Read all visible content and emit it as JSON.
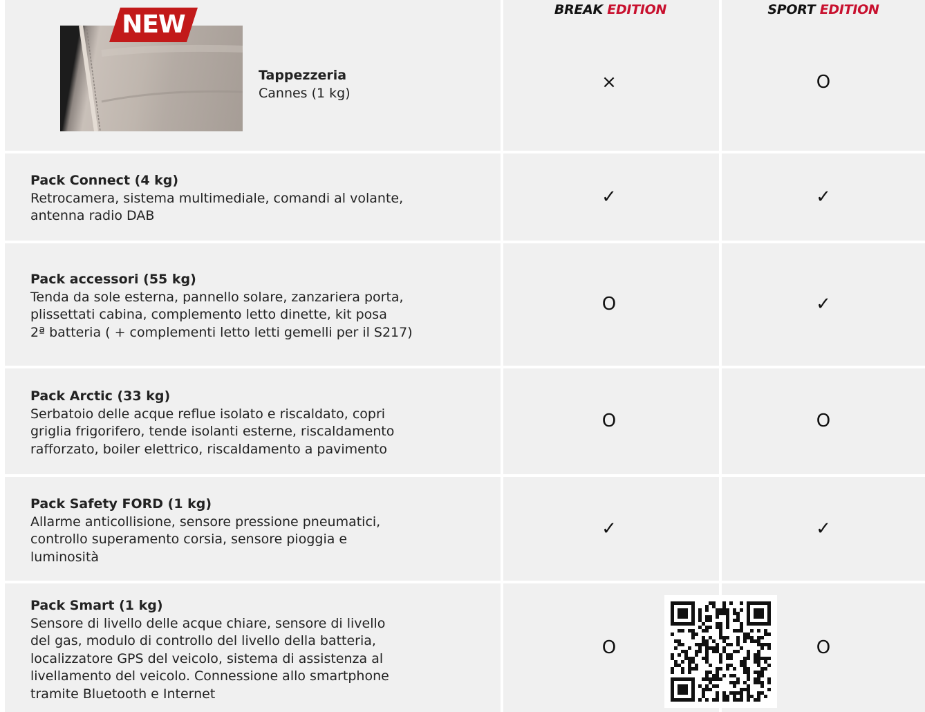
{
  "header": {
    "col1_word": "BREAK",
    "col1_edition": "EDITION",
    "col2_word": "SPORT",
    "col2_edition": "EDITION",
    "accent_color": "#c8102e"
  },
  "badge": {
    "label": "NEW"
  },
  "rows": [
    {
      "title": "Tappezzeria",
      "lines": [
        "Cannes (1 kg)"
      ],
      "break": "×",
      "sport": "O"
    },
    {
      "title": "Pack Connect (4 kg)",
      "lines": [
        "Retrocamera, sistema multimediale, comandi al volante,",
        "antenna radio DAB"
      ],
      "break": "✓",
      "sport": "✓"
    },
    {
      "title": "Pack accessori (55 kg)",
      "lines": [
        "Tenda da sole esterna, pannello solare, zanzariera porta,",
        "plissettati cabina, complemento letto dinette, kit posa",
        "2ª batteria ( + complementi letto letti gemelli per il S217)"
      ],
      "break": "O",
      "sport": "✓"
    },
    {
      "title": "Pack Arctic (33 kg)",
      "lines": [
        "Serbatoio delle acque reflue isolato e riscaldato, copri",
        "griglia frigorifero, tende isolanti esterne, riscaldamento",
        "rafforzato, boiler elettrico, riscaldamento a pavimento"
      ],
      "break": "O",
      "sport": "O"
    },
    {
      "title": "Pack Safety FORD (1 kg)",
      "lines": [
        "Allarme anticollisione, sensore pressione pneumatici,",
        "controllo superamento corsia, sensore pioggia e",
        "luminosità"
      ],
      "break": "✓",
      "sport": "✓"
    },
    {
      "title": "Pack Smart (1 kg)",
      "lines": [
        "Sensore di livello delle acque chiare, sensore di livello",
        "del gas, modulo di controllo del livello della batteria,",
        "localizzatore GPS del veicolo, sistema di assistenza al",
        "livellamento del veicolo. Connessione allo smartphone",
        "tramite Bluetooth e Internet"
      ],
      "break": "O",
      "sport": "O"
    }
  ]
}
